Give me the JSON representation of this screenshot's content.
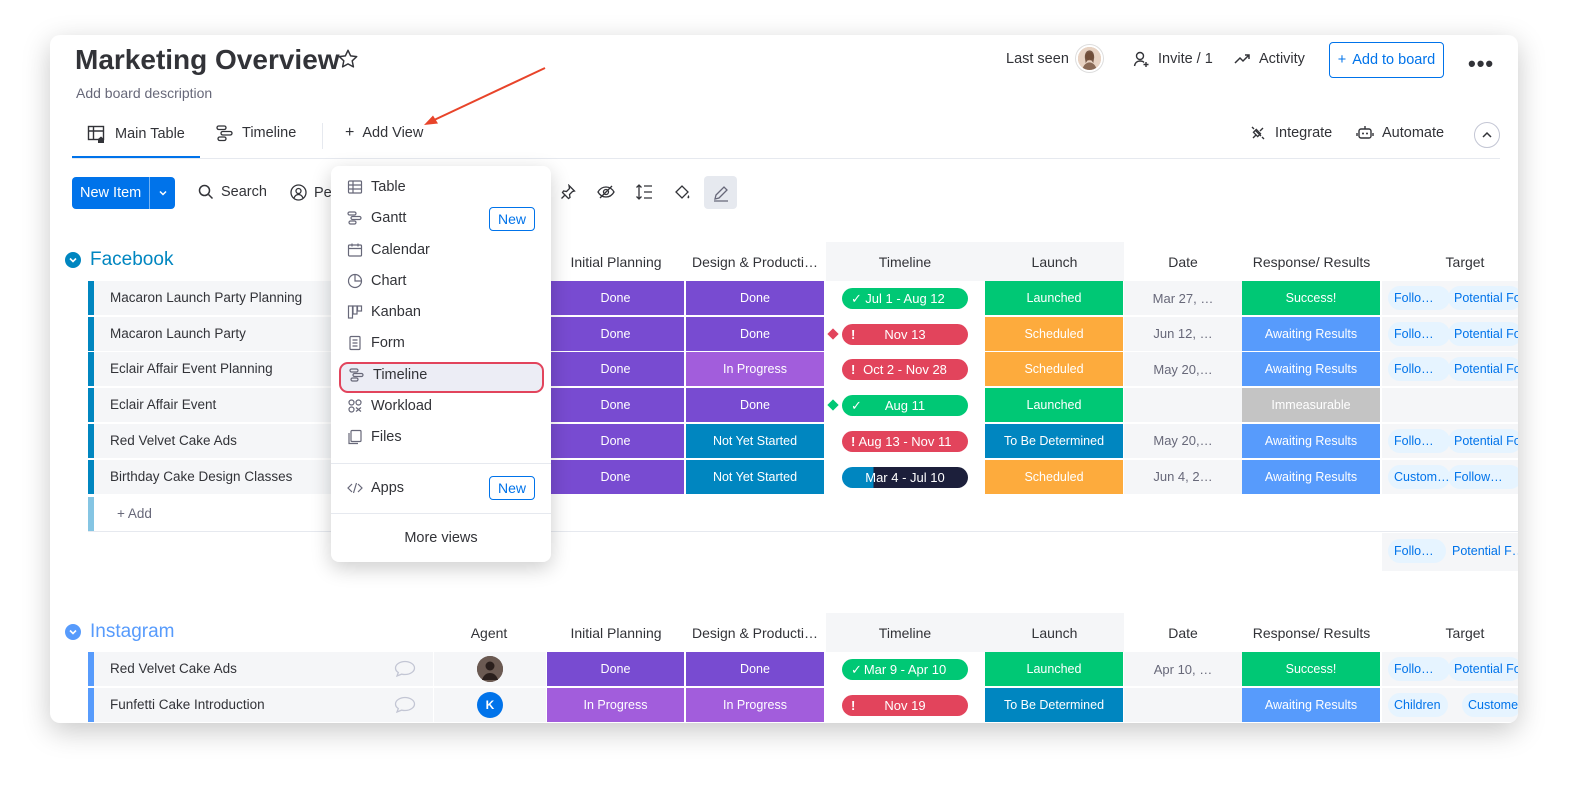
{
  "board": {
    "title": "Marketing Overview",
    "description": "Add board description"
  },
  "header": {
    "last_seen": "Last seen",
    "invite": "Invite / 1",
    "activity": "Activity",
    "add_to_board": "Add to board"
  },
  "tabs": [
    {
      "label": "Main Table",
      "icon": "table-home-icon"
    },
    {
      "label": "Timeline",
      "icon": "timeline-icon"
    },
    {
      "label": "Add View",
      "icon": "plus-icon"
    }
  ],
  "tab_actions": {
    "integrate": "Integrate",
    "automate": "Automate"
  },
  "toolbar": {
    "new_item": "New Item",
    "search": "Search",
    "person": "Pe"
  },
  "view_menu": {
    "items": [
      {
        "label": "Table",
        "icon": "table-icon"
      },
      {
        "label": "Gantt",
        "icon": "gantt-icon",
        "badge": "New"
      },
      {
        "label": "Calendar",
        "icon": "calendar-icon"
      },
      {
        "label": "Chart",
        "icon": "chart-icon"
      },
      {
        "label": "Kanban",
        "icon": "kanban-icon"
      },
      {
        "label": "Form",
        "icon": "form-icon"
      },
      {
        "label": "Timeline",
        "icon": "timeline-icon",
        "highlighted": true
      },
      {
        "label": "Workload",
        "icon": "workload-icon"
      },
      {
        "label": "Files",
        "icon": "files-icon"
      }
    ],
    "apps": {
      "label": "Apps",
      "badge": "New"
    },
    "more": "More views"
  },
  "colors": {
    "done": "#784bd1",
    "in_progress": "#a25ddc",
    "not_yet_started": "#0086c0",
    "green": "#00c875",
    "red": "#e2445c",
    "orange": "#fdab3d",
    "blue_result": "#579bfc",
    "grey": "#c4c4c4",
    "dark": "#1c1f3b",
    "accent": "#0073ea",
    "facebook_group": "#0086c0",
    "instagram_group": "#579bfc"
  },
  "columns": {
    "agent": "Agent",
    "initial": "Initial Planning",
    "design": "Design & Producti…",
    "timeline": "Timeline",
    "launch": "Launch",
    "date": "Date",
    "response": "Response/ Results",
    "target": "Target"
  },
  "facebook": {
    "title": "Facebook",
    "add": "+ Add",
    "rows": [
      {
        "name": "Macaron Launch Party Planning",
        "initial": "Done",
        "design": "Done",
        "timeline": "Jul 1 - Aug 12",
        "launch": "Launched",
        "date": "Mar 27, …",
        "response": "Success!",
        "tag1": "Follo…",
        "tag2": "Potential Fo"
      },
      {
        "name": "Macaron Launch Party",
        "initial": "Done",
        "design": "Done",
        "timeline": "Nov 13",
        "launch": "Scheduled",
        "date": "Jun 12, …",
        "response": "Awaiting Results",
        "tag1": "Follo…",
        "tag2": "Potential Fo"
      },
      {
        "name": "Eclair Affair Event Planning",
        "initial": "Done",
        "design": "In Progress",
        "timeline": "Oct 2 - Nov 28",
        "launch": "Scheduled",
        "date": "May 20,…",
        "response": "Awaiting Results",
        "tag1": "Follo…",
        "tag2": "Potential Fo"
      },
      {
        "name": "Eclair Affair Event",
        "initial": "Done",
        "design": "Done",
        "timeline": "Aug 11",
        "launch": "Launched",
        "date": "",
        "response": "Immeasurable",
        "tag1": "",
        "tag2": ""
      },
      {
        "name": "Red Velvet Cake Ads",
        "initial": "Done",
        "design": "Not Yet Started",
        "timeline": "Aug 13 - Nov 11",
        "launch": "To Be Determined",
        "date": "May 20,…",
        "response": "Awaiting Results",
        "tag1": "Follo…",
        "tag2": "Potential Fo"
      },
      {
        "name": "Birthday Cake Design Classes",
        "initial": "Done",
        "design": "Not Yet Started",
        "timeline": "Mar 4 - Jul 10",
        "launch": "Scheduled",
        "date": "Jun 4, 2…",
        "response": "Awaiting Results",
        "tag1": "Custom…",
        "tag2": "Follow…"
      }
    ],
    "summary_tags": [
      "Follo…",
      "Potential F…"
    ]
  },
  "instagram": {
    "title": "Instagram",
    "rows": [
      {
        "name": "Red Velvet Cake Ads",
        "agent": "",
        "initial": "Done",
        "design": "Done",
        "timeline": "Mar 9 - Apr 10",
        "launch": "Launched",
        "date": "Apr 10, …",
        "response": "Success!",
        "tag1": "Follo…",
        "tag2": "Potential Fo"
      },
      {
        "name": "Funfetti Cake Introduction",
        "agent": "K",
        "initial": "In Progress",
        "design": "In Progress",
        "timeline": "Nov 19",
        "launch": "To Be Determined",
        "date": "",
        "response": "Awaiting Results",
        "tag1": "Children",
        "tag2": "Customer"
      }
    ]
  }
}
